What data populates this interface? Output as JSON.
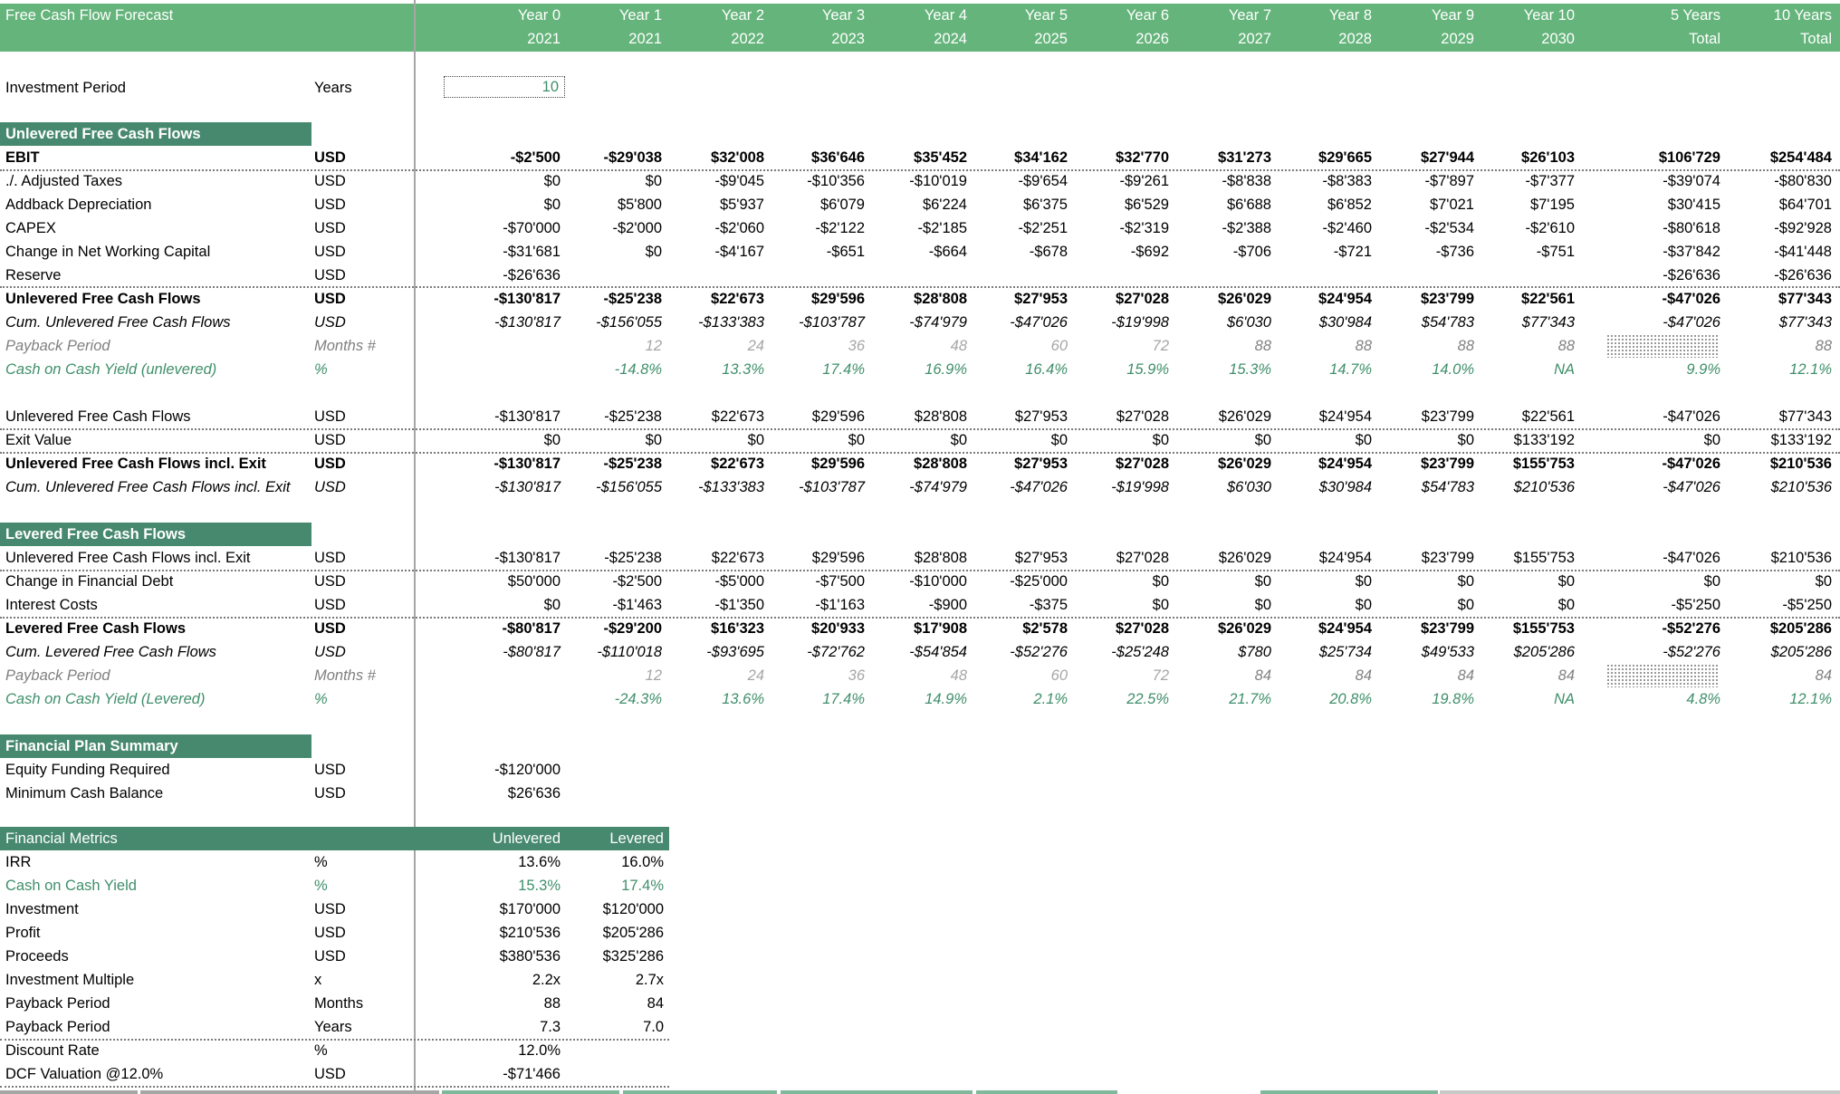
{
  "header": {
    "title": "Free Cash Flow Forecast",
    "columns": [
      {
        "line1": "Year 0",
        "line2": "2021"
      },
      {
        "line1": "Year 1",
        "line2": "2021"
      },
      {
        "line1": "Year 2",
        "line2": "2022"
      },
      {
        "line1": "Year 3",
        "line2": "2023"
      },
      {
        "line1": "Year 4",
        "line2": "2024"
      },
      {
        "line1": "Year 5",
        "line2": "2025"
      },
      {
        "line1": "Year 6",
        "line2": "2026"
      },
      {
        "line1": "Year 7",
        "line2": "2027"
      },
      {
        "line1": "Year 8",
        "line2": "2028"
      },
      {
        "line1": "Year 9",
        "line2": "2029"
      },
      {
        "line1": "Year 10",
        "line2": "2030"
      },
      {
        "line1": "5 Years",
        "line2": "Total"
      },
      {
        "line1": "10 Years",
        "line2": "Total"
      }
    ]
  },
  "investment_period": {
    "label": "Investment Period",
    "unit": "Years",
    "value": "10"
  },
  "colors": {
    "header_green": "#65b47b",
    "section_green": "#47896e",
    "accent_text_green": "#3f8f6a"
  },
  "unlevered": {
    "title": "Unlevered Free Cash Flows",
    "rows": [
      {
        "label": "EBIT",
        "unit": "USD",
        "style": "bold",
        "values": [
          "-$2'500",
          "-$29'038",
          "$32'008",
          "$36'646",
          "$35'452",
          "$34'162",
          "$32'770",
          "$31'273",
          "$29'665",
          "$27'944",
          "$26'103",
          "$106'729",
          "$254'484"
        ]
      },
      {
        "label": "./. Adjusted Taxes",
        "unit": "USD",
        "style": "normal",
        "values": [
          "$0",
          "$0",
          "-$9'045",
          "-$10'356",
          "-$10'019",
          "-$9'654",
          "-$9'261",
          "-$8'838",
          "-$8'383",
          "-$7'897",
          "-$7'377",
          "-$39'074",
          "-$80'830"
        ]
      },
      {
        "label": "Addback Depreciation",
        "unit": "USD",
        "style": "normal",
        "values": [
          "$0",
          "$5'800",
          "$5'937",
          "$6'079",
          "$6'224",
          "$6'375",
          "$6'529",
          "$6'688",
          "$6'852",
          "$7'021",
          "$7'195",
          "$30'415",
          "$64'701"
        ]
      },
      {
        "label": "CAPEX",
        "unit": "USD",
        "style": "normal",
        "values": [
          "-$70'000",
          "-$2'000",
          "-$2'060",
          "-$2'122",
          "-$2'185",
          "-$2'251",
          "-$2'319",
          "-$2'388",
          "-$2'460",
          "-$2'534",
          "-$2'610",
          "-$80'618",
          "-$92'928"
        ]
      },
      {
        "label": "Change in Net Working Capital",
        "unit": "USD",
        "style": "normal",
        "values": [
          "-$31'681",
          "$0",
          "-$4'167",
          "-$651",
          "-$664",
          "-$678",
          "-$692",
          "-$706",
          "-$721",
          "-$736",
          "-$751",
          "-$37'842",
          "-$41'448"
        ]
      },
      {
        "label": "Reserve",
        "unit": "USD",
        "style": "normal",
        "values": [
          "-$26'636",
          "",
          "",
          "",
          "",
          "",
          "",
          "",
          "",
          "",
          "",
          "-$26'636",
          "-$26'636"
        ]
      },
      {
        "label": "Unlevered Free Cash Flows",
        "unit": "USD",
        "style": "bold",
        "values": [
          "-$130'817",
          "-$25'238",
          "$22'673",
          "$29'596",
          "$28'808",
          "$27'953",
          "$27'028",
          "$26'029",
          "$24'954",
          "$23'799",
          "$22'561",
          "-$47'026",
          "$77'343"
        ]
      },
      {
        "label": "Cum. Unlevered Free Cash Flows",
        "unit": "USD",
        "style": "italic",
        "values": [
          "-$130'817",
          "-$156'055",
          "-$133'383",
          "-$103'787",
          "-$74'979",
          "-$47'026",
          "-$19'998",
          "$6'030",
          "$30'984",
          "$54'783",
          "$77'343",
          "-$47'026",
          "$77'343"
        ]
      },
      {
        "label": "Payback Period",
        "unit": "Months #",
        "style": "payback",
        "values": [
          "",
          "12",
          "24",
          "36",
          "48",
          "60",
          "72",
          "88",
          "88",
          "88",
          "88",
          "",
          "88"
        ]
      },
      {
        "label": "Cash on Cash Yield (unlevered)",
        "unit": "%",
        "style": "yield",
        "values": [
          "",
          "-14.8%",
          "13.3%",
          "17.4%",
          "16.9%",
          "16.4%",
          "15.9%",
          "15.3%",
          "14.7%",
          "14.0%",
          "NA",
          "9.9%",
          "12.1%"
        ]
      }
    ],
    "exit_rows": [
      {
        "label": "Unlevered Free Cash Flows",
        "unit": "USD",
        "style": "normal",
        "values": [
          "-$130'817",
          "-$25'238",
          "$22'673",
          "$29'596",
          "$28'808",
          "$27'953",
          "$27'028",
          "$26'029",
          "$24'954",
          "$23'799",
          "$22'561",
          "-$47'026",
          "$77'343"
        ]
      },
      {
        "label": "Exit Value",
        "unit": "USD",
        "style": "normal",
        "values": [
          "$0",
          "$0",
          "$0",
          "$0",
          "$0",
          "$0",
          "$0",
          "$0",
          "$0",
          "$0",
          "$133'192",
          "$0",
          "$133'192"
        ]
      },
      {
        "label": "Unlevered Free Cash Flows incl. Exit",
        "unit": "USD",
        "style": "bold",
        "values": [
          "-$130'817",
          "-$25'238",
          "$22'673",
          "$29'596",
          "$28'808",
          "$27'953",
          "$27'028",
          "$26'029",
          "$24'954",
          "$23'799",
          "$155'753",
          "-$47'026",
          "$210'536"
        ]
      },
      {
        "label": "Cum. Unlevered Free Cash Flows incl. Exit",
        "unit": "USD",
        "style": "italic",
        "values": [
          "-$130'817",
          "-$156'055",
          "-$133'383",
          "-$103'787",
          "-$74'979",
          "-$47'026",
          "-$19'998",
          "$6'030",
          "$30'984",
          "$54'783",
          "$210'536",
          "-$47'026",
          "$210'536"
        ]
      }
    ]
  },
  "levered": {
    "title": "Levered Free Cash Flows",
    "rows": [
      {
        "label": "Unlevered Free Cash Flows incl. Exit",
        "unit": "USD",
        "style": "normal",
        "values": [
          "-$130'817",
          "-$25'238",
          "$22'673",
          "$29'596",
          "$28'808",
          "$27'953",
          "$27'028",
          "$26'029",
          "$24'954",
          "$23'799",
          "$155'753",
          "-$47'026",
          "$210'536"
        ]
      },
      {
        "label": "Change in Financial Debt",
        "unit": "USD",
        "style": "normal",
        "values": [
          "$50'000",
          "-$2'500",
          "-$5'000",
          "-$7'500",
          "-$10'000",
          "-$25'000",
          "$0",
          "$0",
          "$0",
          "$0",
          "$0",
          "$0",
          "$0"
        ]
      },
      {
        "label": "Interest Costs",
        "unit": "USD",
        "style": "normal",
        "values": [
          "$0",
          "-$1'463",
          "-$1'350",
          "-$1'163",
          "-$900",
          "-$375",
          "$0",
          "$0",
          "$0",
          "$0",
          "$0",
          "-$5'250",
          "-$5'250"
        ]
      },
      {
        "label": "Levered Free Cash Flows",
        "unit": "USD",
        "style": "bold",
        "values": [
          "-$80'817",
          "-$29'200",
          "$16'323",
          "$20'933",
          "$17'908",
          "$2'578",
          "$27'028",
          "$26'029",
          "$24'954",
          "$23'799",
          "$155'753",
          "-$52'276",
          "$205'286"
        ]
      },
      {
        "label": "Cum. Levered Free Cash Flows",
        "unit": "USD",
        "style": "italic",
        "values": [
          "-$80'817",
          "-$110'018",
          "-$93'695",
          "-$72'762",
          "-$54'854",
          "-$52'276",
          "-$25'248",
          "$780",
          "$25'734",
          "$49'533",
          "$205'286",
          "-$52'276",
          "$205'286"
        ]
      },
      {
        "label": "Payback Period",
        "unit": "Months #",
        "style": "payback",
        "values": [
          "",
          "12",
          "24",
          "36",
          "48",
          "60",
          "72",
          "84",
          "84",
          "84",
          "84",
          "",
          "84"
        ]
      },
      {
        "label": "Cash on Cash Yield (Levered)",
        "unit": "%",
        "style": "yield",
        "values": [
          "",
          "-24.3%",
          "13.6%",
          "17.4%",
          "14.9%",
          "2.1%",
          "22.5%",
          "21.7%",
          "20.8%",
          "19.8%",
          "NA",
          "4.8%",
          "12.1%"
        ]
      }
    ]
  },
  "summary": {
    "title": "Financial Plan Summary",
    "rows": [
      {
        "label": "Equity Funding Required",
        "unit": "USD",
        "value": "-$120'000"
      },
      {
        "label": "Minimum Cash Balance",
        "unit": "USD",
        "value": "$26'636"
      }
    ]
  },
  "metrics": {
    "title": "Financial Metrics",
    "col_unlevered": "Unlevered",
    "col_levered": "Levered",
    "rows": [
      {
        "label": "IRR",
        "unit": "%",
        "unlevered": "13.6%",
        "levered": "16.0%",
        "style": "normal"
      },
      {
        "label": "Cash on Cash Yield",
        "unit": "%",
        "unlevered": "15.3%",
        "levered": "17.4%",
        "style": "green"
      },
      {
        "label": "Investment",
        "unit": "USD",
        "unlevered": "$170'000",
        "levered": "$120'000",
        "style": "normal"
      },
      {
        "label": "Profit",
        "unit": "USD",
        "unlevered": "$210'536",
        "levered": "$205'286",
        "style": "normal"
      },
      {
        "label": "Proceeds",
        "unit": "USD",
        "unlevered": "$380'536",
        "levered": "$325'286",
        "style": "normal"
      },
      {
        "label": "Investment Multiple",
        "unit": "x",
        "unlevered": "2.2x",
        "levered": "2.7x",
        "style": "normal"
      },
      {
        "label": "Payback Period",
        "unit": "Months",
        "unlevered": "88",
        "levered": "84",
        "style": "normal"
      },
      {
        "label": "Payback Period",
        "unit": "Years",
        "unlevered": "7.3",
        "levered": "7.0",
        "style": "normal"
      },
      {
        "label": "Discount Rate",
        "unit": "%",
        "unlevered": "12.0%",
        "levered": "",
        "style": "normal"
      },
      {
        "label": "DCF Valuation @12.0%",
        "unit": "USD",
        "unlevered": "-$71'466",
        "levered": "",
        "style": "normal"
      }
    ]
  }
}
